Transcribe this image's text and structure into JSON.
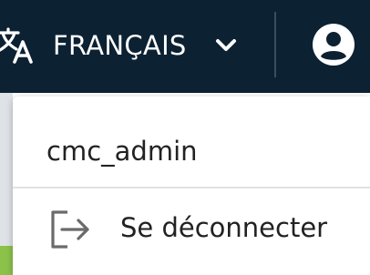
{
  "topbar": {
    "language_icon": "translate-icon",
    "language_label": "FRANÇAIS",
    "chevron_icon": "chevron-down-icon",
    "account_icon": "account-circle-icon"
  },
  "menu": {
    "username": "cmc_admin",
    "logout_icon": "logout-icon",
    "logout_label": "Se déconnecter"
  },
  "colors": {
    "topbar_background": "#0c2132",
    "menu_background": "#ffffff",
    "text": "#222222",
    "icon_gray": "#6b6b6b"
  }
}
